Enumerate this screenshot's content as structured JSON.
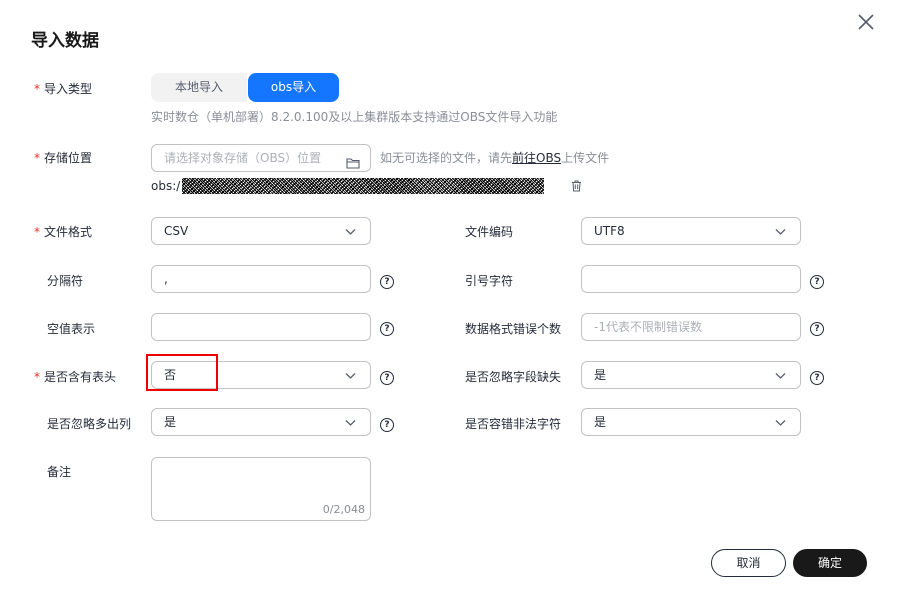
{
  "dialog": {
    "title": "导入数据",
    "cancel_label": "取消",
    "confirm_label": "确定"
  },
  "import_type": {
    "label": "导入类型",
    "options": [
      "本地导入",
      "obs导入"
    ],
    "selected": "obs导入",
    "hint": "实时数仓（单机部署）8.2.0.100及以上集群版本支持通过OBS文件导入功能"
  },
  "storage": {
    "label": "存储位置",
    "placeholder": "请选择对象存储（OBS）位置",
    "hint_prefix": "如无可选择的文件，请先",
    "hint_link": "前往OBS",
    "hint_suffix": "上传文件",
    "path_prefix": "obs:/"
  },
  "file_format": {
    "label": "文件格式",
    "value": "CSV"
  },
  "file_encoding": {
    "label": "文件编码",
    "value": "UTF8"
  },
  "delimiter": {
    "label": "分隔符",
    "value": ","
  },
  "quote_char": {
    "label": "引号字符",
    "value": ""
  },
  "null_value": {
    "label": "空值表示",
    "value": ""
  },
  "error_count": {
    "label": "数据格式错误个数",
    "placeholder": "-1代表不限制错误数"
  },
  "has_header": {
    "label": "是否含有表头",
    "value": "否"
  },
  "ignore_missing": {
    "label": "是否忽略字段缺失",
    "value": "是"
  },
  "ignore_extra": {
    "label": "是否忽略多出列",
    "value": "是"
  },
  "tolerate_illegal": {
    "label": "是否容错非法字符",
    "value": "是"
  },
  "remark": {
    "label": "备注",
    "counter": "0/2,048"
  },
  "colors": {
    "primary": "#1476ff",
    "required": "#e5312b",
    "highlight": "#ee0000",
    "dark_button": "#191919"
  }
}
